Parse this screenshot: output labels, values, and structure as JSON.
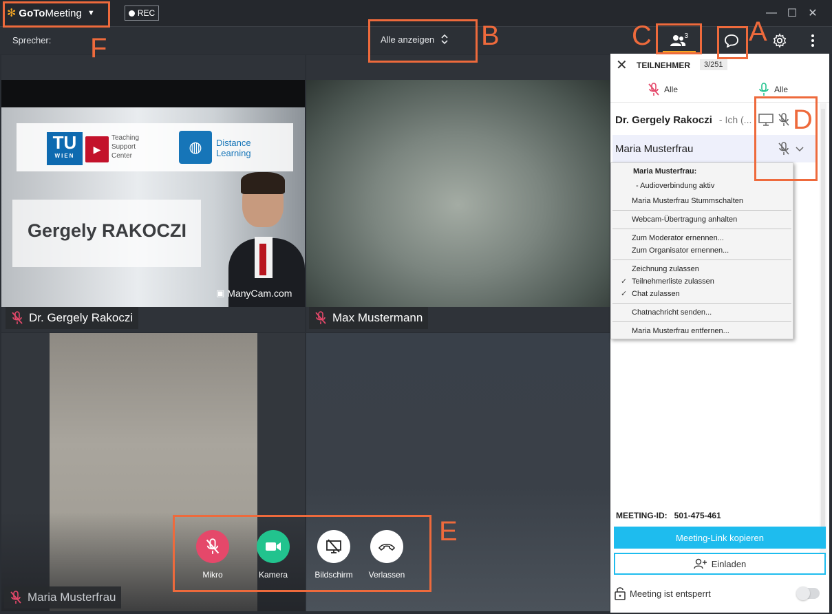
{
  "titlebar": {
    "brand_bold": "GoTo",
    "brand_rest": "Meeting",
    "rec_label": "REC"
  },
  "toolbar": {
    "speaker_label": "Sprecher:",
    "view_select_label": "Alle anzeigen",
    "participant_count": "3"
  },
  "video_tiles": [
    {
      "name": "Dr. Gergely Rakoczi",
      "muted": true
    },
    {
      "name": "Max Mustermann",
      "muted": true
    },
    {
      "name": "Maria Musterfrau",
      "muted": true
    }
  ],
  "slide": {
    "tu_top": "TU",
    "tu_bottom": "WIEN",
    "tsc_line1": "Teaching",
    "tsc_line2": "Support",
    "tsc_line3": "Center",
    "dl_line1": "Distance",
    "dl_line2": "Learning",
    "presenter": "Gergely RAKOCZI",
    "watermark": "ManyCam.com"
  },
  "sidebar": {
    "title": "TEILNEHMER",
    "count": "3/251",
    "mute_all_label": "Alle",
    "unmute_all_label": "Alle",
    "participants": [
      {
        "name": "Dr. Gergely Rakoczi",
        "suffix": "- Ich (...",
        "bold": true
      },
      {
        "name": "Maria Musterfrau",
        "suffix": "",
        "bold": false
      }
    ],
    "meeting_id_label": "MEETING-ID:",
    "meeting_id": "501-475-461",
    "copy_link_label": "Meeting-Link kopieren",
    "invite_label": "Einladen",
    "lock_label": "Meeting ist entsperrt"
  },
  "context_menu": {
    "header": "Maria Musterfrau:",
    "audio_status": "- Audioverbindung aktiv",
    "mute": "Maria Musterfrau Stummschalten",
    "webcam_pause": "Webcam-Übertragung anhalten",
    "make_moderator": "Zum Moderator ernennen...",
    "make_organizer": "Zum Organisator ernennen...",
    "allow_drawing": "Zeichnung zulassen",
    "allow_list": "Teilnehmerliste zulassen",
    "allow_chat": "Chat zulassen",
    "send_chat": "Chatnachricht senden...",
    "remove": "Maria Musterfrau entfernen..."
  },
  "controls": {
    "mic_label": "Mikro",
    "camera_label": "Kamera",
    "screen_label": "Bildschirm",
    "leave_label": "Verlassen"
  },
  "annotations": [
    "A",
    "B",
    "C",
    "D",
    "E",
    "F"
  ],
  "colors": {
    "accent_orange": "#ee6a3c",
    "brand_yellow": "#f5a623",
    "mic_red": "#e5486a",
    "camera_green": "#22c38e",
    "link_blue": "#1ebcee"
  }
}
